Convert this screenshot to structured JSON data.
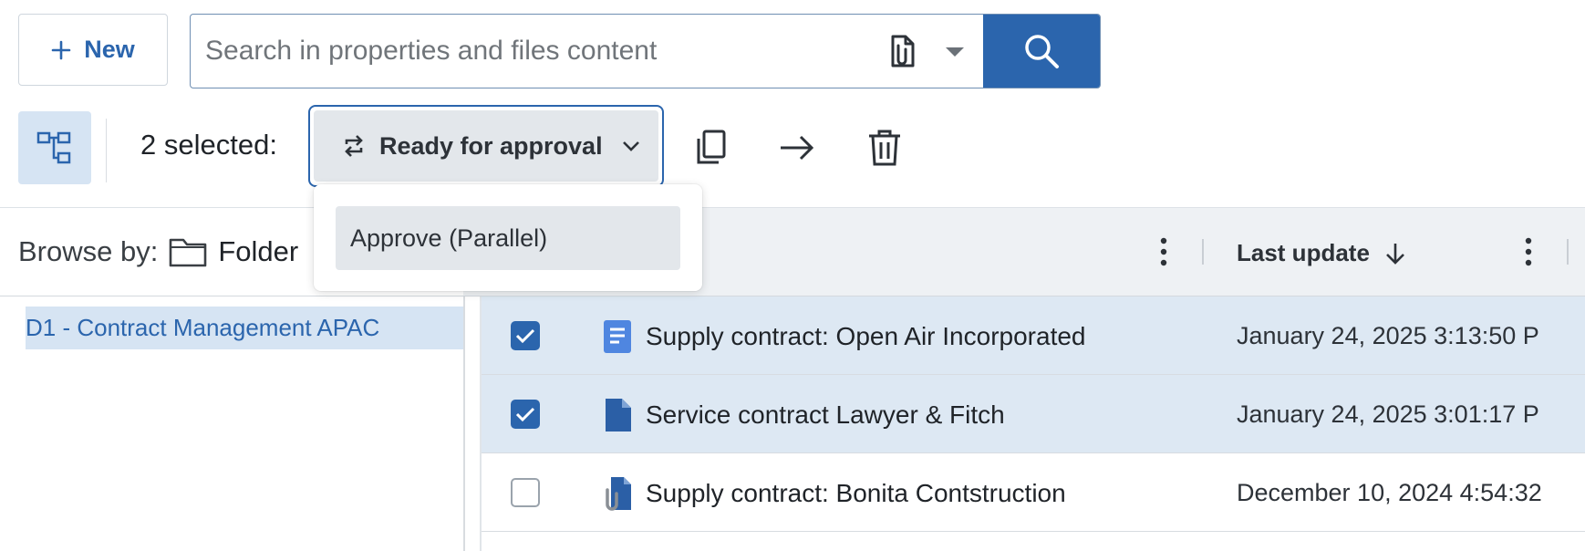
{
  "toolbar": {
    "new_label": "New",
    "search_placeholder": "Search in properties and files content"
  },
  "selection": {
    "count_label": "2 selected:",
    "status_action_label": "Ready for approval",
    "dropdown_items": [
      {
        "label": "Approve (Parallel)"
      }
    ]
  },
  "browse": {
    "label": "Browse by:",
    "value": "Folder",
    "tree": [
      {
        "label": "D1 - Contract Management APAC",
        "selected": true
      }
    ]
  },
  "table": {
    "columns": {
      "last_update": "Last update"
    },
    "rows": [
      {
        "title": "Supply contract: Open Air Incorporated",
        "date": "January 24, 2025 3:13:50 P",
        "checked": true,
        "icon": "text-document-icon"
      },
      {
        "title": "Service contract Lawyer & Fitch",
        "date": "January 24, 2025 3:01:17 P",
        "checked": true,
        "icon": "document-icon"
      },
      {
        "title": "Supply contract: Bonita Contstruction",
        "date": "December 10, 2024 4:54:32",
        "checked": false,
        "icon": "attachment-document-icon"
      }
    ]
  },
  "colors": {
    "accent": "#2b65ad",
    "selected_row": "#dde8f3",
    "header_band": "#eef1f4"
  }
}
